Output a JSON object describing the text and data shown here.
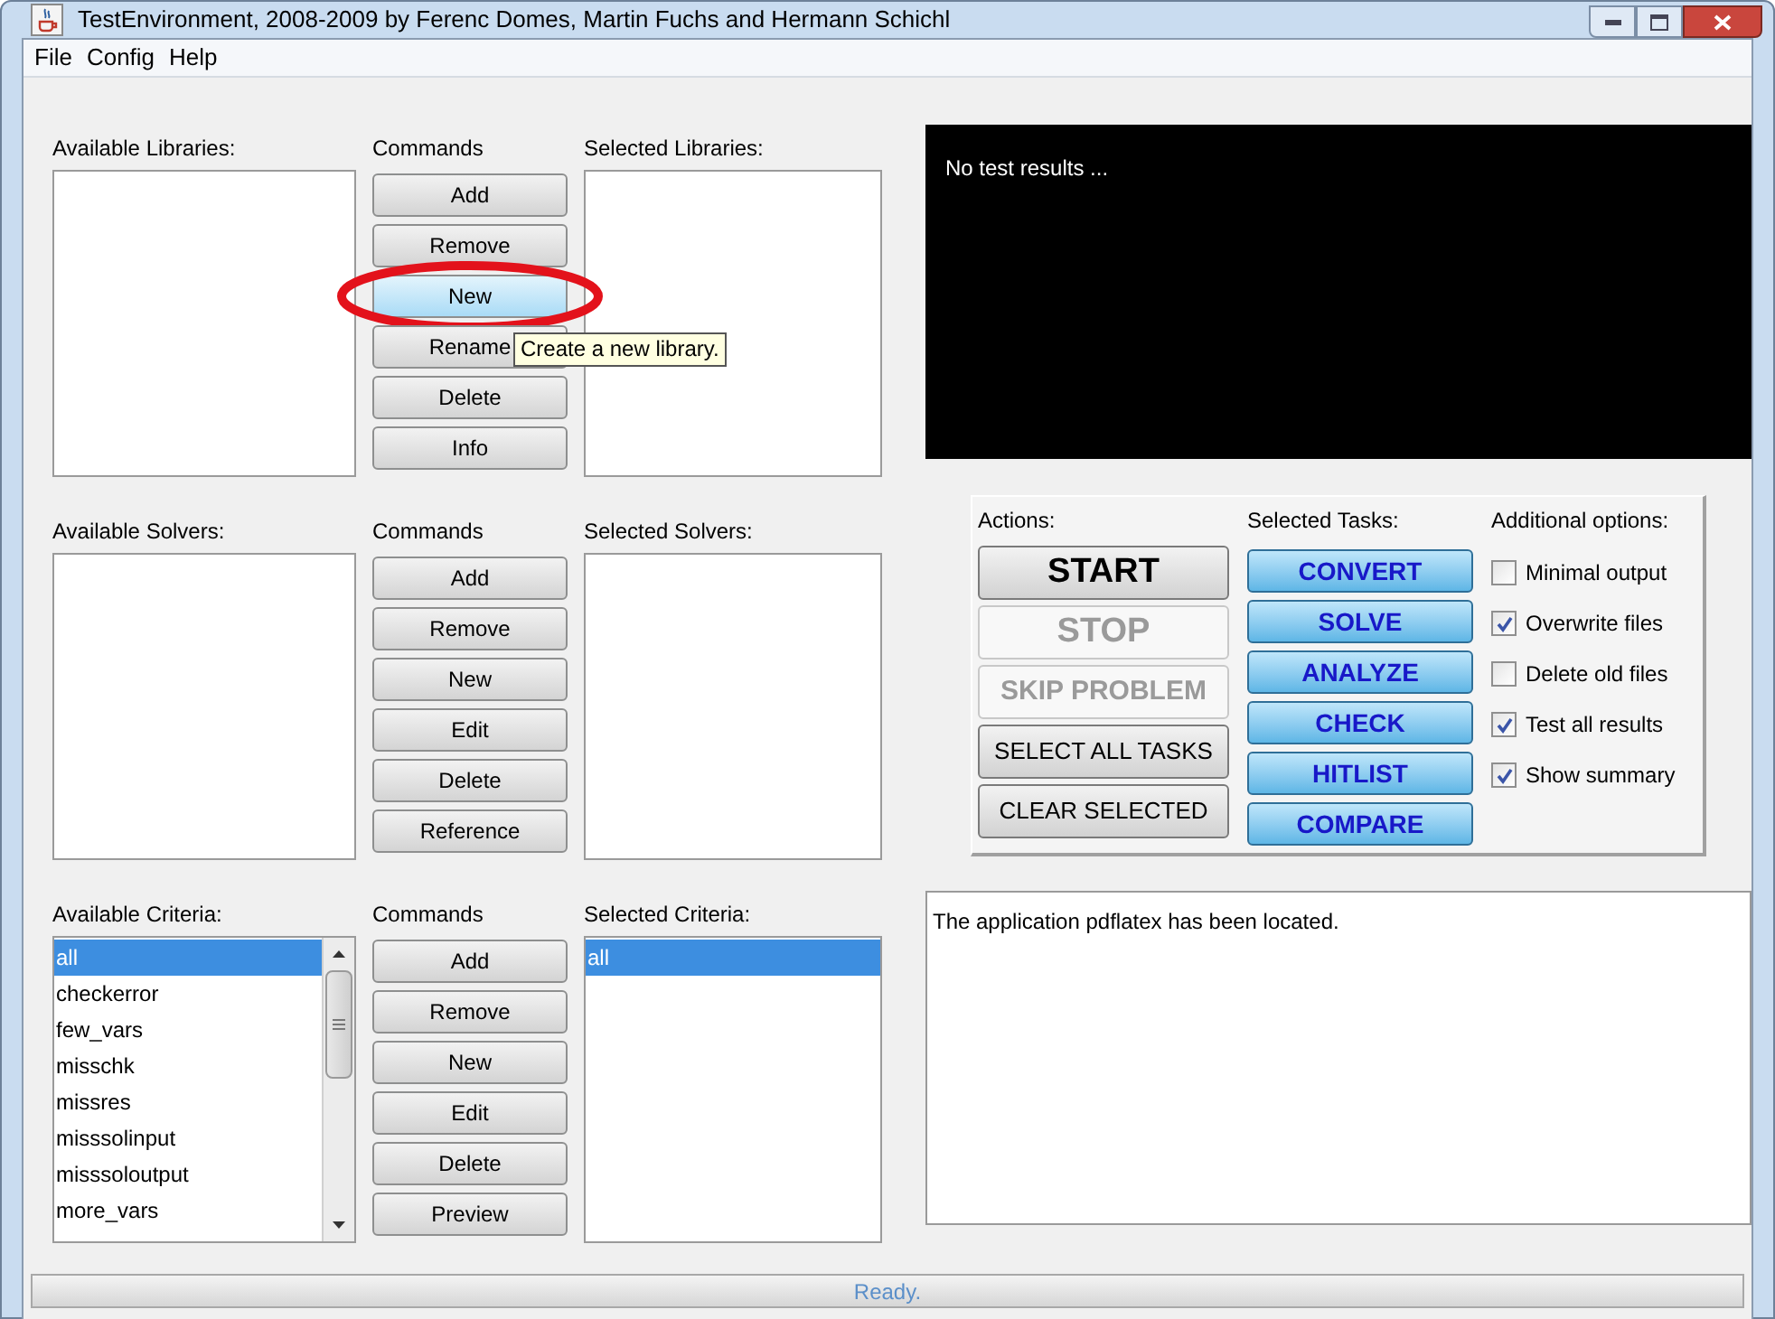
{
  "window": {
    "title": "TestEnvironment, 2008-2009 by Ferenc Domes, Martin Fuchs and Hermann Schichl"
  },
  "menu": [
    {
      "label": "File"
    },
    {
      "label": "Config"
    },
    {
      "label": "Help"
    }
  ],
  "sections": [
    {
      "available_label": "Available Libraries:",
      "commands_label": "Commands",
      "selected_label": "Selected Libraries:",
      "commands": [
        {
          "label": "Add",
          "highlighted": false
        },
        {
          "label": "Remove",
          "highlighted": false
        },
        {
          "label": "New",
          "highlighted": true
        },
        {
          "label": "Rename",
          "highlighted": false
        },
        {
          "label": "Delete",
          "highlighted": false
        },
        {
          "label": "Info",
          "highlighted": false
        }
      ],
      "tooltip": {
        "text": "Create a new library."
      }
    },
    {
      "available_label": "Available Solvers:",
      "commands_label": "Commands",
      "selected_label": "Selected Solvers:",
      "commands": [
        {
          "label": "Add",
          "highlighted": false
        },
        {
          "label": "Remove",
          "highlighted": false
        },
        {
          "label": "New",
          "highlighted": false
        },
        {
          "label": "Edit",
          "highlighted": false
        },
        {
          "label": "Delete",
          "highlighted": false
        },
        {
          "label": "Reference",
          "highlighted": false
        }
      ]
    },
    {
      "available_label": "Available Criteria:",
      "commands_label": "Commands",
      "selected_label": "Selected Criteria:",
      "scrollable": true,
      "available_items": [
        {
          "label": "all",
          "selected": true
        },
        {
          "label": "checkerror",
          "selected": false
        },
        {
          "label": "few_vars",
          "selected": false
        },
        {
          "label": "misschk",
          "selected": false
        },
        {
          "label": "missres",
          "selected": false
        },
        {
          "label": "misssolinput",
          "selected": false
        },
        {
          "label": "misssoloutput",
          "selected": false
        },
        {
          "label": "more_vars",
          "selected": false
        }
      ],
      "selected_items": [
        {
          "label": "all",
          "selected": true
        }
      ],
      "commands": [
        {
          "label": "Add",
          "highlighted": false
        },
        {
          "label": "Remove",
          "highlighted": false
        },
        {
          "label": "New",
          "highlighted": false
        },
        {
          "label": "Edit",
          "highlighted": false
        },
        {
          "label": "Delete",
          "highlighted": false
        },
        {
          "label": "Preview",
          "highlighted": false
        }
      ]
    }
  ],
  "results": {
    "text": "No test results ..."
  },
  "control_panel": {
    "actions_label": "Actions:",
    "tasks_label": "Selected Tasks:",
    "options_label": "Additional options:",
    "actions": [
      {
        "label": "START",
        "kind": "large",
        "disabled": false
      },
      {
        "label": "STOP",
        "kind": "large",
        "disabled": true
      },
      {
        "label": "SKIP PROBLEM",
        "kind": "bold",
        "disabled": true
      },
      {
        "label": "SELECT ALL TASKS",
        "kind": "normal",
        "disabled": false
      },
      {
        "label": "CLEAR SELECTED",
        "kind": "normal",
        "disabled": false
      }
    ],
    "tasks": [
      {
        "label": "CONVERT",
        "selected": true
      },
      {
        "label": "SOLVE",
        "selected": true
      },
      {
        "label": "ANALYZE",
        "selected": true
      },
      {
        "label": "CHECK",
        "selected": true
      },
      {
        "label": "HITLIST",
        "selected": true
      },
      {
        "label": "COMPARE",
        "selected": true
      }
    ],
    "options": [
      {
        "label": "Minimal output",
        "checked": false
      },
      {
        "label": "Overwrite files",
        "checked": true
      },
      {
        "label": "Delete old files",
        "checked": false
      },
      {
        "label": "Test all results",
        "checked": true
      },
      {
        "label": "Show summary",
        "checked": true
      }
    ]
  },
  "log": {
    "text": "The application pdflatex has been located."
  },
  "status_bar": {
    "text": "Ready."
  }
}
